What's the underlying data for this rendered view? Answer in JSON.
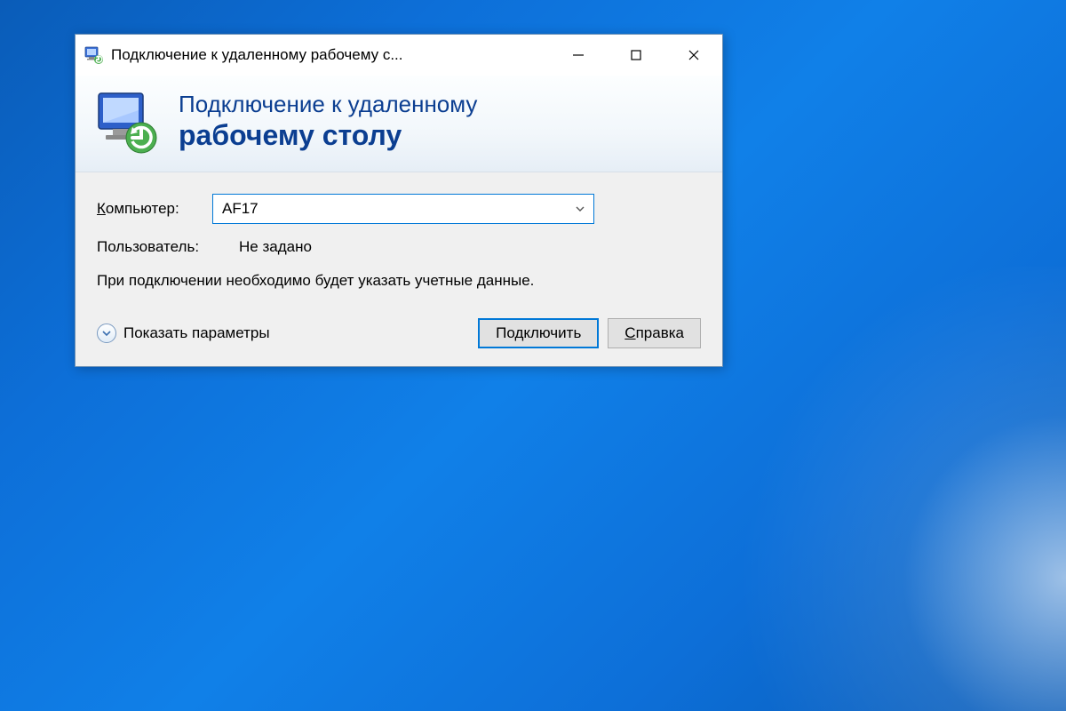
{
  "window": {
    "title": "Подключение к удаленному рабочему с..."
  },
  "header": {
    "line1": "Подключение к удаленному",
    "line2": "рабочему столу"
  },
  "form": {
    "computer_label_prefix": "К",
    "computer_label_rest": "омпьютер:",
    "computer_value": "AF17",
    "user_label": "Пользователь:",
    "user_value": "Не задано",
    "info_text": "При подключении необходимо будет указать учетные данные."
  },
  "footer": {
    "show_options_prefix": "П",
    "show_options_rest": "оказать параметры",
    "connect_label": "Подключить",
    "help_prefix": "С",
    "help_rest": "правка"
  }
}
